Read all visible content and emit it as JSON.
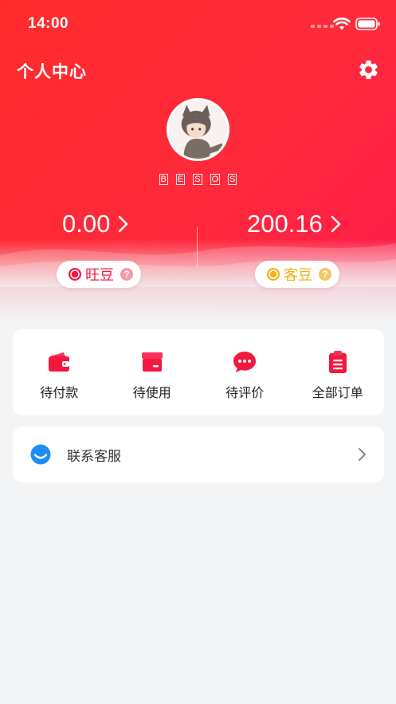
{
  "status_bar": {
    "time": "14:00"
  },
  "header": {
    "title": "个人中心"
  },
  "profile": {
    "username_chars": [
      "B",
      "E",
      "S",
      "O",
      "S"
    ]
  },
  "wallet": {
    "left_value": "0.00",
    "right_value": "200.16",
    "left_label": "旺豆",
    "right_label": "客豆",
    "help_mark": "?"
  },
  "orders": [
    {
      "label": "待付款",
      "icon": "wallet-icon"
    },
    {
      "label": "待使用",
      "icon": "box-icon"
    },
    {
      "label": "待评价",
      "icon": "chat-bubble-icon"
    },
    {
      "label": "全部订单",
      "icon": "clipboard-icon"
    }
  ],
  "service": {
    "label": "联系客服",
    "icon": "smile-icon"
  },
  "colors": {
    "brand": "#ff2b3b",
    "accent_gold": "#f1b21a",
    "service_blue": "#1e8cf5"
  }
}
